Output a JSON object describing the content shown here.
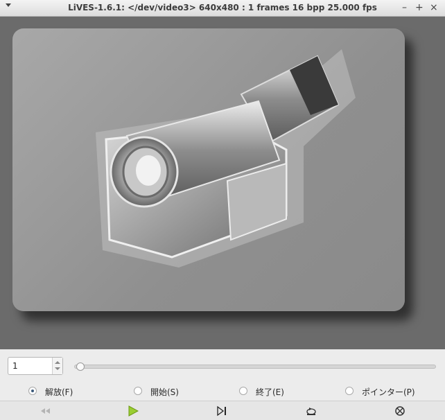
{
  "window": {
    "title": "LiVES-1.6.1: </dev/video3> 640x480 : 1 frames 16 bpp 25.000 fps"
  },
  "controls": {
    "frame_value": "1",
    "radios": [
      {
        "label": "解放(F)",
        "selected": true
      },
      {
        "label": "開始(S)",
        "selected": false
      },
      {
        "label": "終了(E)",
        "selected": false
      },
      {
        "label": "ポインター(P)",
        "selected": false
      }
    ]
  },
  "toolbar": {
    "buttons": [
      "rewind-icon",
      "play-icon",
      "step-forward-icon",
      "loop-icon",
      "stop-record-icon"
    ]
  },
  "colors": {
    "play_green": "#9acd32",
    "viewport_bg": "#6b6b6b"
  }
}
